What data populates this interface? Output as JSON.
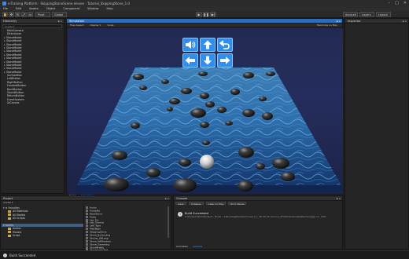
{
  "window": {
    "title": "e-Training Platform - SkippingStoneScene.eleven - Tutorial_SkippingStone_1.0",
    "controls": [
      "–",
      "□",
      "✕"
    ]
  },
  "menu": [
    "File",
    "Edit",
    "Assets",
    "Object",
    "Component",
    "Window",
    "Help"
  ],
  "toolbar": {
    "pivot_label": "Pivot",
    "global_label": "Global",
    "play_icons": [
      "▶",
      "❚❚",
      "▶|"
    ],
    "account_label": "Account",
    "layers_label": "Layers",
    "layout_label": "Layout"
  },
  "hierarchy": {
    "title": "Hierarchy",
    "search_placeholder": "Create ▾",
    "items": [
      {
        "label": "MainCamera",
        "child": true
      },
      {
        "label": "Directional",
        "child": true
      },
      {
        "label": "StoneModel",
        "child": false
      },
      {
        "label": "StoneModel",
        "child": false
      },
      {
        "label": "StoneModel",
        "child": false
      },
      {
        "label": "StoneModel",
        "child": false
      },
      {
        "label": "StoneModel",
        "child": false
      },
      {
        "label": "StoneModel",
        "child": false
      },
      {
        "label": "StoneModel",
        "child": false
      },
      {
        "label": "StoneModel",
        "child": false
      },
      {
        "label": "StoneModel",
        "child": false
      },
      {
        "label": "StoneModel",
        "child": false
      },
      {
        "label": "StoneModel",
        "child": false
      },
      {
        "label": "SurfaceBox",
        "child": true
      },
      {
        "label": "LeftButton",
        "child": true
      },
      {
        "label": "RightButton",
        "child": true
      },
      {
        "label": "ForwardButton",
        "child": true
      },
      {
        "label": "BackButton",
        "child": true
      },
      {
        "label": "SoundButton",
        "child": true
      },
      {
        "label": "ReturnButton",
        "child": true
      },
      {
        "label": "EventSystem",
        "child": true
      },
      {
        "label": "UICanvas",
        "child": true
      }
    ]
  },
  "viewport": {
    "title": "Simulation",
    "sub": [
      "Free Aspect",
      "Display 1",
      "Scale",
      "Maximize on Play"
    ],
    "bottom_tabs": [
      "Scene",
      "Simulation"
    ],
    "controls": [
      "sound-icon",
      "up-arrow-icon",
      "return-icon",
      "left-arrow-icon",
      "down-arrow-icon",
      "right-arrow-icon"
    ],
    "colors": {
      "button": "#2f8ef2",
      "water": "#2f6fb8"
    }
  },
  "inspector": {
    "title": "Inspector"
  },
  "project": {
    "title": "Project",
    "create_label": "Create ▾",
    "tree": [
      {
        "label": "▾ ★ Favorites",
        "indent": 0,
        "selected": false
      },
      {
        "label": "All Materials",
        "indent": 1,
        "selected": false
      },
      {
        "label": "All Models",
        "indent": 1,
        "selected": false
      },
      {
        "label": "All Scripts",
        "indent": 1,
        "selected": false
      },
      {
        "label": "",
        "indent": 0,
        "selected": false
      },
      {
        "label": "▾ Assets",
        "indent": 0,
        "selected": true
      },
      {
        "label": "Audios",
        "indent": 1,
        "selected": false
      },
      {
        "label": "Models",
        "indent": 1,
        "selected": false
      },
      {
        "label": "Script",
        "indent": 1,
        "selected": false
      }
    ],
    "files": [
      "Audio",
      "Fonts/Ba",
      "BackStone",
      "Fonts",
      "Lab_Tut",
      "Lab_Tutorial",
      "Left_Type",
      "MainBgm",
      "SkippingStone",
      "Stone_BoilerLang",
      "Stones_OffLang",
      "Stone_OffShaders",
      "Stone_Slamming",
      "StonePrefab",
      "StoneAudioTrail",
      "Structure_Container"
    ]
  },
  "console": {
    "title": "Console",
    "buttons": [
      "Clear",
      "Collapse",
      "Clear on Play",
      "Error Pause"
    ],
    "message_title": "Build Succeeded",
    "message_path": "C:\\Projects\\BuildOutput - Finish - e-BuildingStoneSim3.exe 1+, 3D 20 Ok Source_CFC/Proto/Scripts/Filemanager.cs : 0KO",
    "bottom_tabs": [
      "Animation",
      "Console"
    ]
  },
  "status": {
    "text": "Build Succeeded"
  }
}
